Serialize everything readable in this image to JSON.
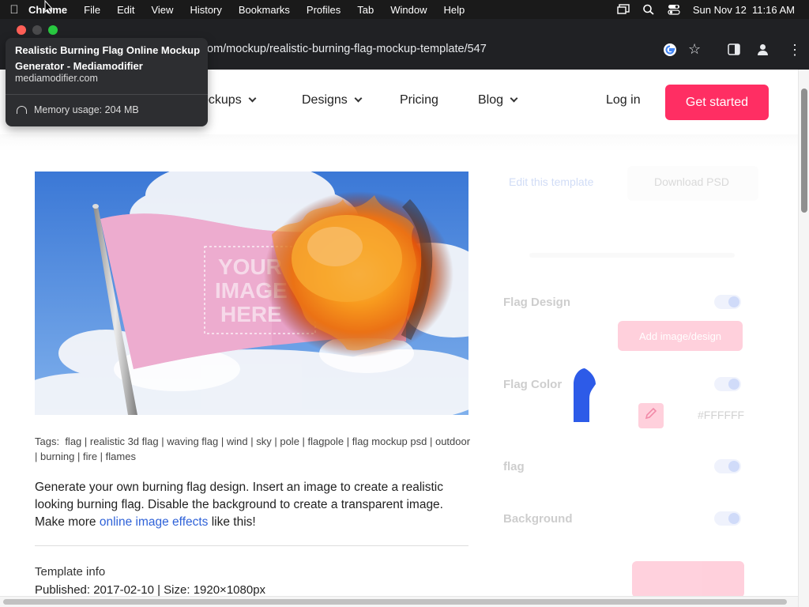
{
  "menubar": {
    "app": "Chrome",
    "items": [
      "File",
      "Edit",
      "View",
      "History",
      "Bookmarks",
      "Profiles",
      "Tab",
      "Window",
      "Help"
    ],
    "clock": "Sun Nov 12  11:16 AM"
  },
  "browser": {
    "url": "om/mockup/realistic-burning-flag-mockup-template/547"
  },
  "tooltip": {
    "title": "Realistic Burning Flag Online Mockup Generator - Mediamodifier",
    "domain": "mediamodifier.com",
    "memory": "Memory usage: 204 MB"
  },
  "nav": {
    "mockups": "ockups",
    "designs": "Designs",
    "pricing": "Pricing",
    "blog": "Blog",
    "login": "Log in",
    "cta": "Get started"
  },
  "image": {
    "overlay_text_1": "YOUR",
    "overlay_text_2": "IMAGE",
    "overlay_text_3": "HERE"
  },
  "tags": {
    "label": "Tags:",
    "items": [
      "flag",
      "realistic 3d flag",
      "waving flag",
      "wind",
      "sky",
      "pole",
      "flagpole",
      "flag mockup psd",
      "outdoor",
      "burning",
      "fire",
      "flames"
    ]
  },
  "description": {
    "text1": "Generate your own burning flag design. Insert an image to create a realistic looking burning flag. Disable the background to create a transparent image. Make more ",
    "link": "online image effects",
    "text2": " like this!"
  },
  "template_info": {
    "heading": "Template info",
    "meta": "Published: 2017-02-10 | Size: 1920×1080px"
  },
  "panel": {
    "tab_edit": "Edit this template",
    "tab_download": "Download PSD",
    "section_1": "Flag Design",
    "add_image": "Add image/design",
    "section_2": "Flag Color",
    "hex": "#FFFFFF",
    "section_3": "flag",
    "section_4": "Background"
  },
  "colors": {
    "accent": "#ff2e63",
    "link": "#2f62d8",
    "toggle": "#2f5fe8"
  }
}
